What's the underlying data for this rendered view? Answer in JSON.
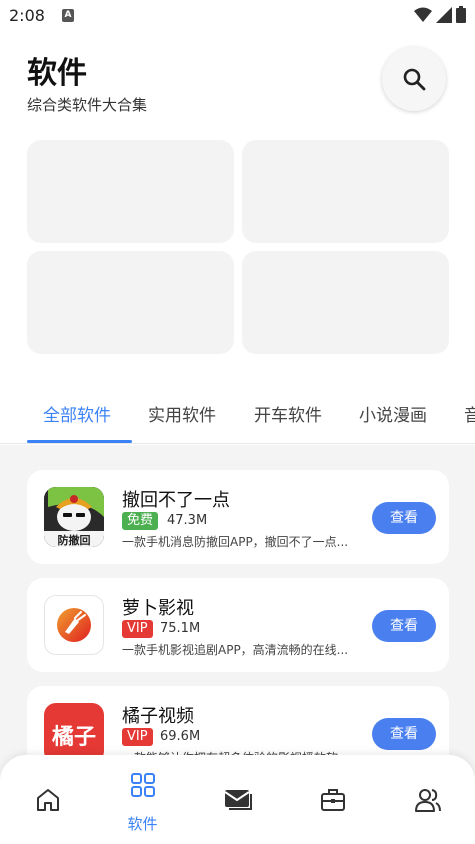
{
  "status_bar": {
    "time": "2:08",
    "notification_letter": "A"
  },
  "header": {
    "title": "软件",
    "subtitle": "综合类软件大合集"
  },
  "tabs": [
    {
      "label": "全部软件",
      "active": true
    },
    {
      "label": "实用软件",
      "active": false
    },
    {
      "label": "开车软件",
      "active": false
    },
    {
      "label": "小说漫画",
      "active": false
    },
    {
      "label": "音",
      "active": false
    }
  ],
  "apps": [
    {
      "name": "撤回不了一点",
      "badge": "免费",
      "badge_color": "#4caf50",
      "size": "47.3M",
      "description": "一款手机消息防撤回APP，撤回不了一点...",
      "button": "查看",
      "icon": "anti-recall-app-icon",
      "icon_text": "防撤回"
    },
    {
      "name": "萝卜影视",
      "badge": "VIP",
      "badge_color": "#e53935",
      "size": "75.1M",
      "description": "一款手机影视追剧APP，高清流畅的在线...",
      "button": "查看",
      "icon": "luobo-video-app-icon"
    },
    {
      "name": "橘子视频",
      "badge": "VIP",
      "badge_color": "#e53935",
      "size": "69.6M",
      "description": "一款能够让你拥有超多体验的影视播放软...",
      "button": "查看",
      "icon": "juzi-video-app-icon",
      "icon_text": "橘子"
    }
  ],
  "bottom_nav": [
    {
      "icon": "home-icon",
      "label": "",
      "active": false
    },
    {
      "icon": "grid-icon",
      "label": "软件",
      "active": true
    },
    {
      "icon": "mail-icon",
      "label": "",
      "active": false
    },
    {
      "icon": "toolbox-icon",
      "label": "",
      "active": false
    },
    {
      "icon": "users-icon",
      "label": "",
      "active": false
    }
  ],
  "colors": {
    "accent": "#3b82f6",
    "button": "#4a7ff0",
    "list_bg": "#f4f4f4"
  }
}
